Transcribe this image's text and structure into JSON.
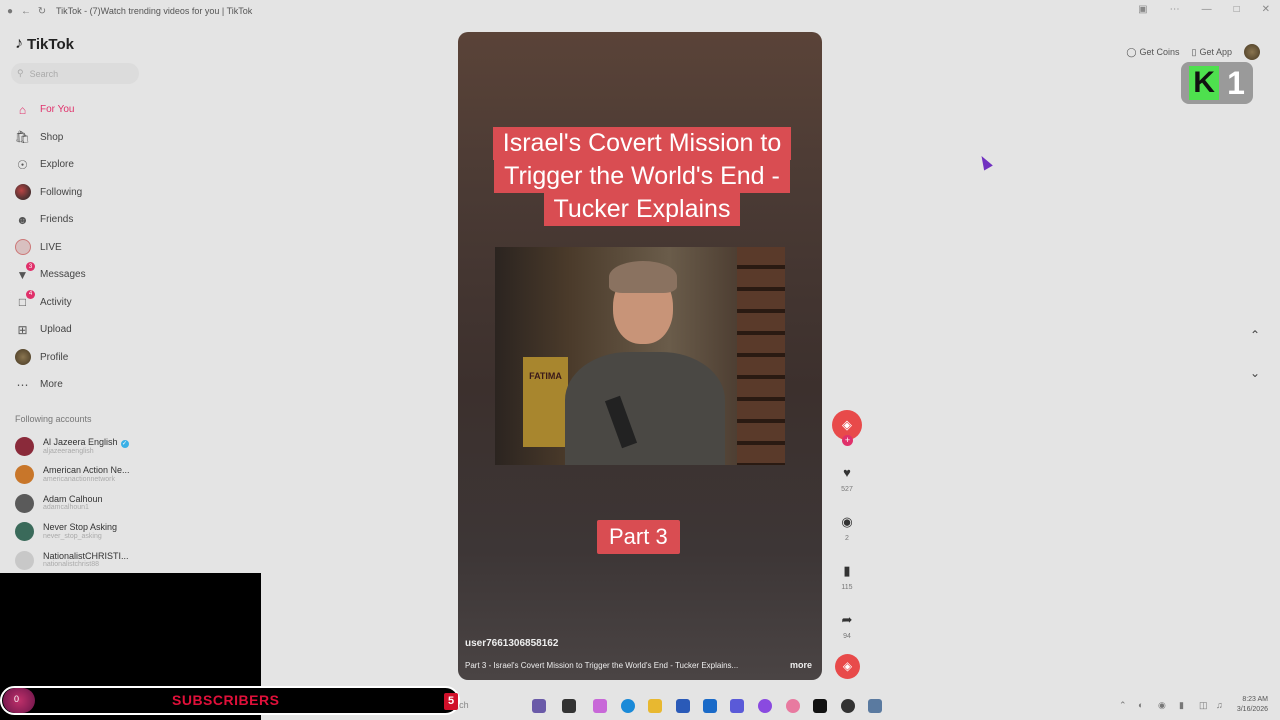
{
  "browser": {
    "tab_title": "TikTok - (7)Watch trending videos for you | TikTok"
  },
  "app": {
    "name": "TikTok"
  },
  "search": {
    "placeholder": "Search"
  },
  "nav": [
    {
      "label": "For You",
      "icon": "home-icon",
      "active": true
    },
    {
      "label": "Shop",
      "icon": "shop-icon"
    },
    {
      "label": "Explore",
      "icon": "compass-icon"
    },
    {
      "label": "Following",
      "icon": "following-avatar"
    },
    {
      "label": "Friends",
      "icon": "friends-icon"
    },
    {
      "label": "LIVE",
      "icon": "live-avatar"
    },
    {
      "label": "Messages",
      "icon": "messages-icon",
      "badge": "3"
    },
    {
      "label": "Activity",
      "icon": "activity-icon",
      "badge": "4"
    },
    {
      "label": "Upload",
      "icon": "upload-icon"
    },
    {
      "label": "Profile",
      "icon": "profile-avatar"
    },
    {
      "label": "More",
      "icon": "more-icon"
    }
  ],
  "following": {
    "heading": "Following accounts",
    "accounts": [
      {
        "name": "Al Jazeera English",
        "handle": "aljazeeraenglish",
        "verified": true,
        "color": "#8a2a3a"
      },
      {
        "name": "American Action Ne...",
        "handle": "americanactionnetwork",
        "color": "#c8762a"
      },
      {
        "name": "Adam Calhoun",
        "handle": "adamcalhoun1",
        "color": "#5a5a5a"
      },
      {
        "name": "Never Stop Asking",
        "handle": "never_stop_asking",
        "color": "#3a6a5a"
      },
      {
        "name": "NationalistCHRISTI...",
        "handle": "nationalistchrist88",
        "color": "#c8c8c8"
      }
    ]
  },
  "overlay": {
    "subscribers_label": "SUBSCRIBERS",
    "subscribers_count": "5",
    "left_number": "0"
  },
  "video": {
    "headline_lines": [
      "Israel's Covert Mission to",
      "Trigger the World's End -",
      "Tucker Explains"
    ],
    "sign_text": "FATIMA",
    "part_label": "Part 3",
    "username": "user7661306858162",
    "description": "Part 3 - Israel's Covert Mission to Trigger the World's End - Tucker Explains...",
    "more_label": "more"
  },
  "actions": {
    "likes": "527",
    "comments": "2",
    "saves": "115",
    "shares": "94"
  },
  "header_right": {
    "get_coins": "Get Coins",
    "get_app": "Get App"
  },
  "kbadge": {
    "letter": "K",
    "number": "1"
  },
  "taskbar": {
    "search_label": "Search",
    "time": "8:23 AM",
    "date": "3/16/2026"
  }
}
